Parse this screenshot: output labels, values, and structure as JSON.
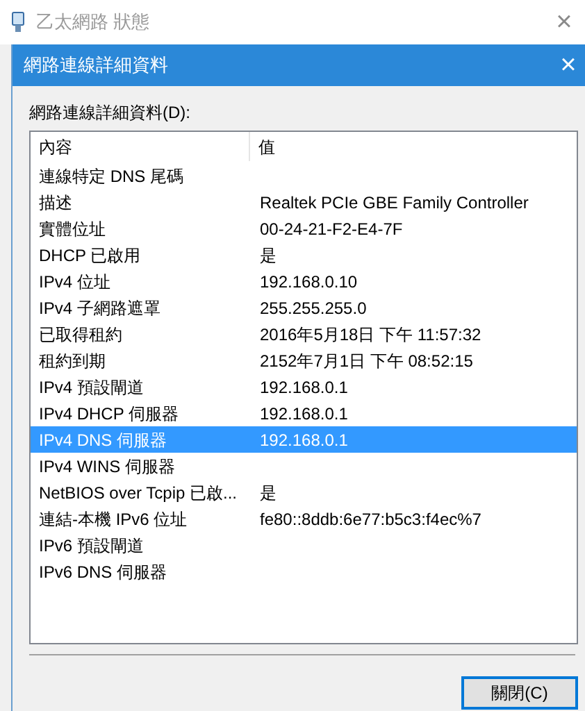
{
  "parent_window": {
    "title": "乙太網路 狀態",
    "close": "×"
  },
  "dialog": {
    "title": "網路連線詳細資料",
    "close": "×",
    "list_label": "網路連線詳細資料(D):"
  },
  "table": {
    "columns": [
      "內容",
      "值"
    ],
    "rows": [
      {
        "property": "連線特定 DNS 尾碼",
        "value": "",
        "selected": false
      },
      {
        "property": "描述",
        "value": "Realtek PCIe GBE Family Controller",
        "selected": false
      },
      {
        "property": "實體位址",
        "value": "00-24-21-F2-E4-7F",
        "selected": false
      },
      {
        "property": "DHCP 已啟用",
        "value": "是",
        "selected": false
      },
      {
        "property": "IPv4 位址",
        "value": "192.168.0.10",
        "selected": false
      },
      {
        "property": "IPv4 子網路遮罩",
        "value": "255.255.255.0",
        "selected": false
      },
      {
        "property": "已取得租約",
        "value": "2016年5月18日 下午 11:57:32",
        "selected": false
      },
      {
        "property": "租約到期",
        "value": "2152年7月1日 下午 08:52:15",
        "selected": false
      },
      {
        "property": "IPv4 預設閘道",
        "value": "192.168.0.1",
        "selected": false
      },
      {
        "property": "IPv4 DHCP 伺服器",
        "value": "192.168.0.1",
        "selected": false
      },
      {
        "property": "IPv4 DNS 伺服器",
        "value": "192.168.0.1",
        "selected": true
      },
      {
        "property": "IPv4 WINS 伺服器",
        "value": "",
        "selected": false
      },
      {
        "property": "NetBIOS over Tcpip 已啟...",
        "value": "是",
        "selected": false
      },
      {
        "property": "連結-本機 IPv6 位址",
        "value": "fe80::8ddb:6e77:b5c3:f4ec%7",
        "selected": false
      },
      {
        "property": "IPv6 預設閘道",
        "value": "",
        "selected": false
      },
      {
        "property": "IPv6 DNS 伺服器",
        "value": "",
        "selected": false
      }
    ]
  },
  "buttons": [
    "關閉(C)"
  ]
}
